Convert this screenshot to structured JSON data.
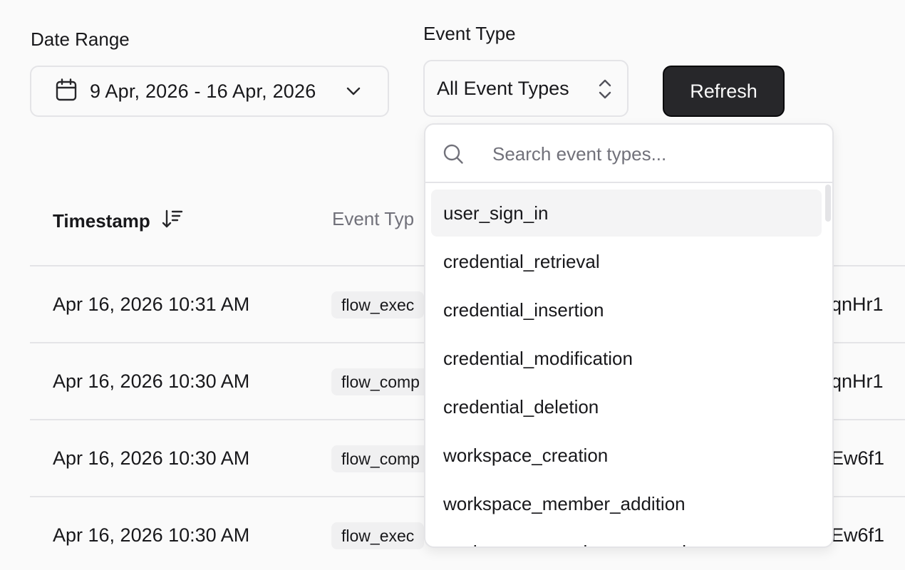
{
  "filters": {
    "date_range_label": "Date Range",
    "date_range_value": "9 Apr, 2026 - 16 Apr, 2026",
    "event_type_label": "Event Type",
    "event_type_value": "All Event Types",
    "refresh_label": "Refresh"
  },
  "table": {
    "headers": {
      "timestamp": "Timestamp",
      "event_type": "Event Typ"
    },
    "rows": [
      {
        "timestamp": "Apr 16, 2026 10:31 AM",
        "event": "flow_exec",
        "id": "qnHr1"
      },
      {
        "timestamp": "Apr 16, 2026 10:30 AM",
        "event": "flow_comp",
        "id": "qnHr1"
      },
      {
        "timestamp": "Apr 16, 2026 10:30 AM",
        "event": "flow_comp",
        "id": "Ew6f1"
      },
      {
        "timestamp": "Apr 16, 2026 10:30 AM",
        "event": "flow_exec",
        "id": "Ew6f1"
      }
    ]
  },
  "dropdown": {
    "search_placeholder": "Search event types...",
    "options": [
      "user_sign_in",
      "credential_retrieval",
      "credential_insertion",
      "credential_modification",
      "credential_deletion",
      "workspace_creation",
      "workspace_member_addition",
      "workspace_member_removal"
    ],
    "highlighted_index": 0
  },
  "icons": {
    "calendar": "calendar-icon",
    "chevron": "chevron-down-icon",
    "updown": "chevrons-up-down-icon",
    "sort": "sort-descending-icon",
    "search": "search-icon"
  },
  "colors": {
    "primary_button": "#27272a",
    "border": "#e4e4e7",
    "muted_text": "#71717a",
    "highlight": "#f4f4f5"
  }
}
